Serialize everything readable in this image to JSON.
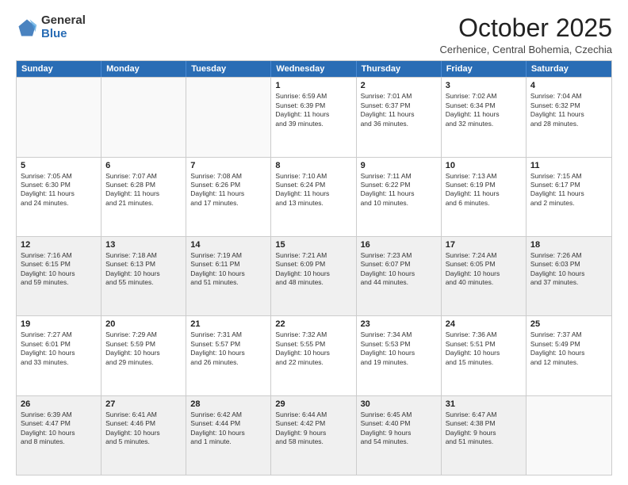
{
  "logo": {
    "general": "General",
    "blue": "Blue"
  },
  "header": {
    "month": "October 2025",
    "location": "Cerhenice, Central Bohemia, Czechia"
  },
  "weekdays": [
    "Sunday",
    "Monday",
    "Tuesday",
    "Wednesday",
    "Thursday",
    "Friday",
    "Saturday"
  ],
  "rows": [
    [
      {
        "day": "",
        "empty": true,
        "lines": []
      },
      {
        "day": "",
        "empty": true,
        "lines": []
      },
      {
        "day": "",
        "empty": true,
        "lines": []
      },
      {
        "day": "1",
        "lines": [
          "Sunrise: 6:59 AM",
          "Sunset: 6:39 PM",
          "Daylight: 11 hours",
          "and 39 minutes."
        ]
      },
      {
        "day": "2",
        "lines": [
          "Sunrise: 7:01 AM",
          "Sunset: 6:37 PM",
          "Daylight: 11 hours",
          "and 36 minutes."
        ]
      },
      {
        "day": "3",
        "lines": [
          "Sunrise: 7:02 AM",
          "Sunset: 6:34 PM",
          "Daylight: 11 hours",
          "and 32 minutes."
        ]
      },
      {
        "day": "4",
        "lines": [
          "Sunrise: 7:04 AM",
          "Sunset: 6:32 PM",
          "Daylight: 11 hours",
          "and 28 minutes."
        ]
      }
    ],
    [
      {
        "day": "5",
        "lines": [
          "Sunrise: 7:05 AM",
          "Sunset: 6:30 PM",
          "Daylight: 11 hours",
          "and 24 minutes."
        ]
      },
      {
        "day": "6",
        "lines": [
          "Sunrise: 7:07 AM",
          "Sunset: 6:28 PM",
          "Daylight: 11 hours",
          "and 21 minutes."
        ]
      },
      {
        "day": "7",
        "lines": [
          "Sunrise: 7:08 AM",
          "Sunset: 6:26 PM",
          "Daylight: 11 hours",
          "and 17 minutes."
        ]
      },
      {
        "day": "8",
        "lines": [
          "Sunrise: 7:10 AM",
          "Sunset: 6:24 PM",
          "Daylight: 11 hours",
          "and 13 minutes."
        ]
      },
      {
        "day": "9",
        "lines": [
          "Sunrise: 7:11 AM",
          "Sunset: 6:22 PM",
          "Daylight: 11 hours",
          "and 10 minutes."
        ]
      },
      {
        "day": "10",
        "lines": [
          "Sunrise: 7:13 AM",
          "Sunset: 6:19 PM",
          "Daylight: 11 hours",
          "and 6 minutes."
        ]
      },
      {
        "day": "11",
        "lines": [
          "Sunrise: 7:15 AM",
          "Sunset: 6:17 PM",
          "Daylight: 11 hours",
          "and 2 minutes."
        ]
      }
    ],
    [
      {
        "day": "12",
        "shaded": true,
        "lines": [
          "Sunrise: 7:16 AM",
          "Sunset: 6:15 PM",
          "Daylight: 10 hours",
          "and 59 minutes."
        ]
      },
      {
        "day": "13",
        "shaded": true,
        "lines": [
          "Sunrise: 7:18 AM",
          "Sunset: 6:13 PM",
          "Daylight: 10 hours",
          "and 55 minutes."
        ]
      },
      {
        "day": "14",
        "shaded": true,
        "lines": [
          "Sunrise: 7:19 AM",
          "Sunset: 6:11 PM",
          "Daylight: 10 hours",
          "and 51 minutes."
        ]
      },
      {
        "day": "15",
        "shaded": true,
        "lines": [
          "Sunrise: 7:21 AM",
          "Sunset: 6:09 PM",
          "Daylight: 10 hours",
          "and 48 minutes."
        ]
      },
      {
        "day": "16",
        "shaded": true,
        "lines": [
          "Sunrise: 7:23 AM",
          "Sunset: 6:07 PM",
          "Daylight: 10 hours",
          "and 44 minutes."
        ]
      },
      {
        "day": "17",
        "shaded": true,
        "lines": [
          "Sunrise: 7:24 AM",
          "Sunset: 6:05 PM",
          "Daylight: 10 hours",
          "and 40 minutes."
        ]
      },
      {
        "day": "18",
        "shaded": true,
        "lines": [
          "Sunrise: 7:26 AM",
          "Sunset: 6:03 PM",
          "Daylight: 10 hours",
          "and 37 minutes."
        ]
      }
    ],
    [
      {
        "day": "19",
        "lines": [
          "Sunrise: 7:27 AM",
          "Sunset: 6:01 PM",
          "Daylight: 10 hours",
          "and 33 minutes."
        ]
      },
      {
        "day": "20",
        "lines": [
          "Sunrise: 7:29 AM",
          "Sunset: 5:59 PM",
          "Daylight: 10 hours",
          "and 29 minutes."
        ]
      },
      {
        "day": "21",
        "lines": [
          "Sunrise: 7:31 AM",
          "Sunset: 5:57 PM",
          "Daylight: 10 hours",
          "and 26 minutes."
        ]
      },
      {
        "day": "22",
        "lines": [
          "Sunrise: 7:32 AM",
          "Sunset: 5:55 PM",
          "Daylight: 10 hours",
          "and 22 minutes."
        ]
      },
      {
        "day": "23",
        "lines": [
          "Sunrise: 7:34 AM",
          "Sunset: 5:53 PM",
          "Daylight: 10 hours",
          "and 19 minutes."
        ]
      },
      {
        "day": "24",
        "lines": [
          "Sunrise: 7:36 AM",
          "Sunset: 5:51 PM",
          "Daylight: 10 hours",
          "and 15 minutes."
        ]
      },
      {
        "day": "25",
        "lines": [
          "Sunrise: 7:37 AM",
          "Sunset: 5:49 PM",
          "Daylight: 10 hours",
          "and 12 minutes."
        ]
      }
    ],
    [
      {
        "day": "26",
        "shaded": true,
        "lines": [
          "Sunrise: 6:39 AM",
          "Sunset: 4:47 PM",
          "Daylight: 10 hours",
          "and 8 minutes."
        ]
      },
      {
        "day": "27",
        "shaded": true,
        "lines": [
          "Sunrise: 6:41 AM",
          "Sunset: 4:46 PM",
          "Daylight: 10 hours",
          "and 5 minutes."
        ]
      },
      {
        "day": "28",
        "shaded": true,
        "lines": [
          "Sunrise: 6:42 AM",
          "Sunset: 4:44 PM",
          "Daylight: 10 hours",
          "and 1 minute."
        ]
      },
      {
        "day": "29",
        "shaded": true,
        "lines": [
          "Sunrise: 6:44 AM",
          "Sunset: 4:42 PM",
          "Daylight: 9 hours",
          "and 58 minutes."
        ]
      },
      {
        "day": "30",
        "shaded": true,
        "lines": [
          "Sunrise: 6:45 AM",
          "Sunset: 4:40 PM",
          "Daylight: 9 hours",
          "and 54 minutes."
        ]
      },
      {
        "day": "31",
        "shaded": true,
        "lines": [
          "Sunrise: 6:47 AM",
          "Sunset: 4:38 PM",
          "Daylight: 9 hours",
          "and 51 minutes."
        ]
      },
      {
        "day": "",
        "empty": true,
        "lines": []
      }
    ]
  ]
}
